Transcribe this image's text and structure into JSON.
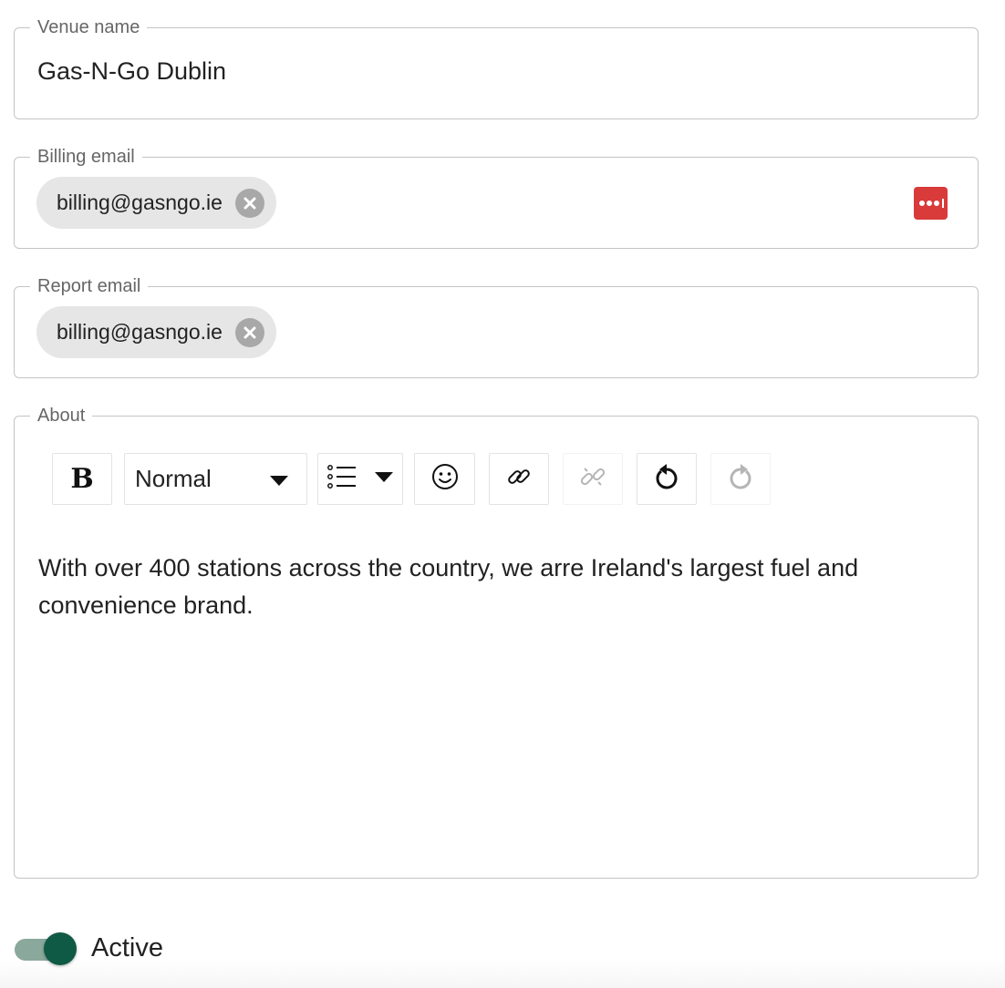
{
  "venue_name": {
    "label": "Venue name",
    "value": "Gas-N-Go Dublin"
  },
  "billing_email": {
    "label": "Billing email",
    "chips": [
      "billing@gasngo.ie"
    ],
    "password_manager_icon": "password-manager-icon"
  },
  "report_email": {
    "label": "Report email",
    "chips": [
      "billing@gasngo.ie"
    ]
  },
  "about": {
    "label": "About",
    "toolbar": {
      "bold": "bold-icon",
      "block_type": "Normal",
      "list": "list-icon",
      "emoji": "emoji-icon",
      "link": "link-icon",
      "unlink": "unlink-icon",
      "undo": "undo-icon",
      "redo": "redo-icon"
    },
    "content": "With over 400 stations across the country, we arre Ireland's largest fuel and convenience brand."
  },
  "active_toggle": {
    "label": "Active",
    "on": true,
    "color": "#0e5a45"
  },
  "colors": {
    "accent": "#0e5a45",
    "chip_bg": "#e6e6e6",
    "badge": "#d93a3a",
    "border": "#c4c4c4"
  }
}
